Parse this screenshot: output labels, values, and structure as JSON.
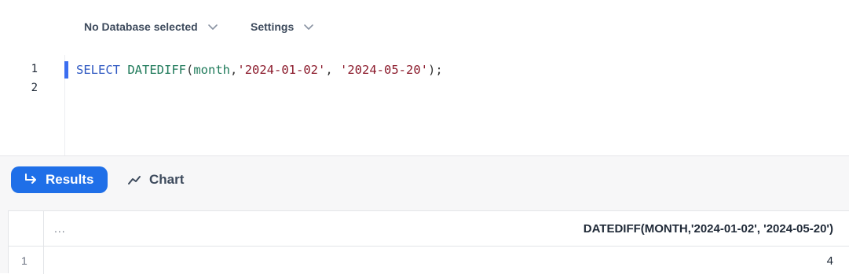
{
  "toolbar": {
    "database_label": "No Database selected",
    "settings_label": "Settings"
  },
  "editor": {
    "line_numbers": [
      "1",
      "2"
    ],
    "code": {
      "keyword": "SELECT",
      "function": "DATEDIFF",
      "open": "(",
      "arg1": "month",
      "comma1": ",",
      "arg2": "'2024-01-02'",
      "comma2": ", ",
      "arg3": "'2024-05-20'",
      "close": ");"
    }
  },
  "results_tabs": {
    "results_label": "Results",
    "chart_label": "Chart"
  },
  "table": {
    "menu_label": "...",
    "column_header": "DATEDIFF(MONTH,'2024-01-02', '2024-05-20')",
    "rows": [
      {
        "index": "1",
        "value": "4"
      }
    ]
  },
  "colors": {
    "accent": "#1f6fe8",
    "cursor": "#3b6ef0",
    "keyword": "#2f59c2",
    "string": "#8b1a2b"
  }
}
